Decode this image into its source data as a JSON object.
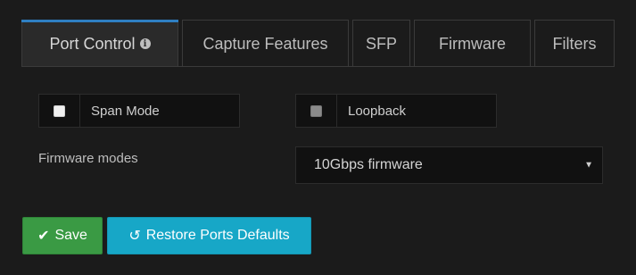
{
  "tabs": [
    {
      "label": "Port Control",
      "active": true,
      "icon": "info-icon"
    },
    {
      "label": "Capture Features",
      "active": false
    },
    {
      "label": "SFP",
      "active": false
    },
    {
      "label": "Firmware",
      "active": false
    },
    {
      "label": "Filters",
      "active": false
    }
  ],
  "port_control": {
    "span_mode": {
      "label": "Span Mode",
      "checked": false
    },
    "loopback": {
      "label": "Loopback",
      "checked": false,
      "disabled": true
    },
    "firmware_modes": {
      "label": "Firmware modes",
      "selected": "10Gbps firmware",
      "caret": "▼"
    }
  },
  "actions": {
    "save": {
      "label": "Save",
      "icon": "check-icon",
      "color": "#3a9a44"
    },
    "restore": {
      "label": "Restore Ports Defaults",
      "icon": "undo-icon",
      "color": "#17a7c7"
    }
  },
  "colors": {
    "background": "#1b1b1b",
    "active_tab_accent": "#2f7fc2"
  }
}
